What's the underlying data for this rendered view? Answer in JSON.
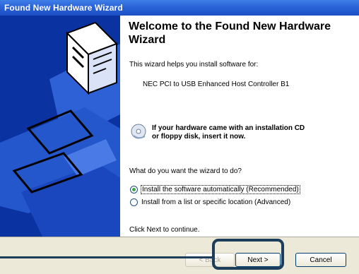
{
  "window": {
    "title": "Found New Hardware Wizard"
  },
  "main": {
    "heading": "Welcome to the Found New Hardware Wizard",
    "intro": "This wizard helps you install software for:",
    "device": "NEC PCI to USB Enhanced Host Controller B1",
    "cd_notice_line1": "If your hardware came with an installation CD",
    "cd_notice_line2": "or floppy disk, insert it now.",
    "question": "What do you want the wizard to do?",
    "options": [
      {
        "label": "Install the software automatically (Recommended)",
        "selected": true
      },
      {
        "label": "Install from a list or specific location (Advanced)",
        "selected": false
      }
    ],
    "continue_hint": "Click Next to continue."
  },
  "buttons": {
    "back": "< Back",
    "next": "Next >",
    "cancel": "Cancel"
  },
  "icons": {
    "side_graphic": "hardware-box-icon",
    "cd": "cd-disk-icon"
  },
  "colors": {
    "title_bar": "#2a62d8",
    "side_panel": "#0a32a0",
    "callout": "#1d3e5a",
    "radio_selected": "#3fa83a"
  }
}
